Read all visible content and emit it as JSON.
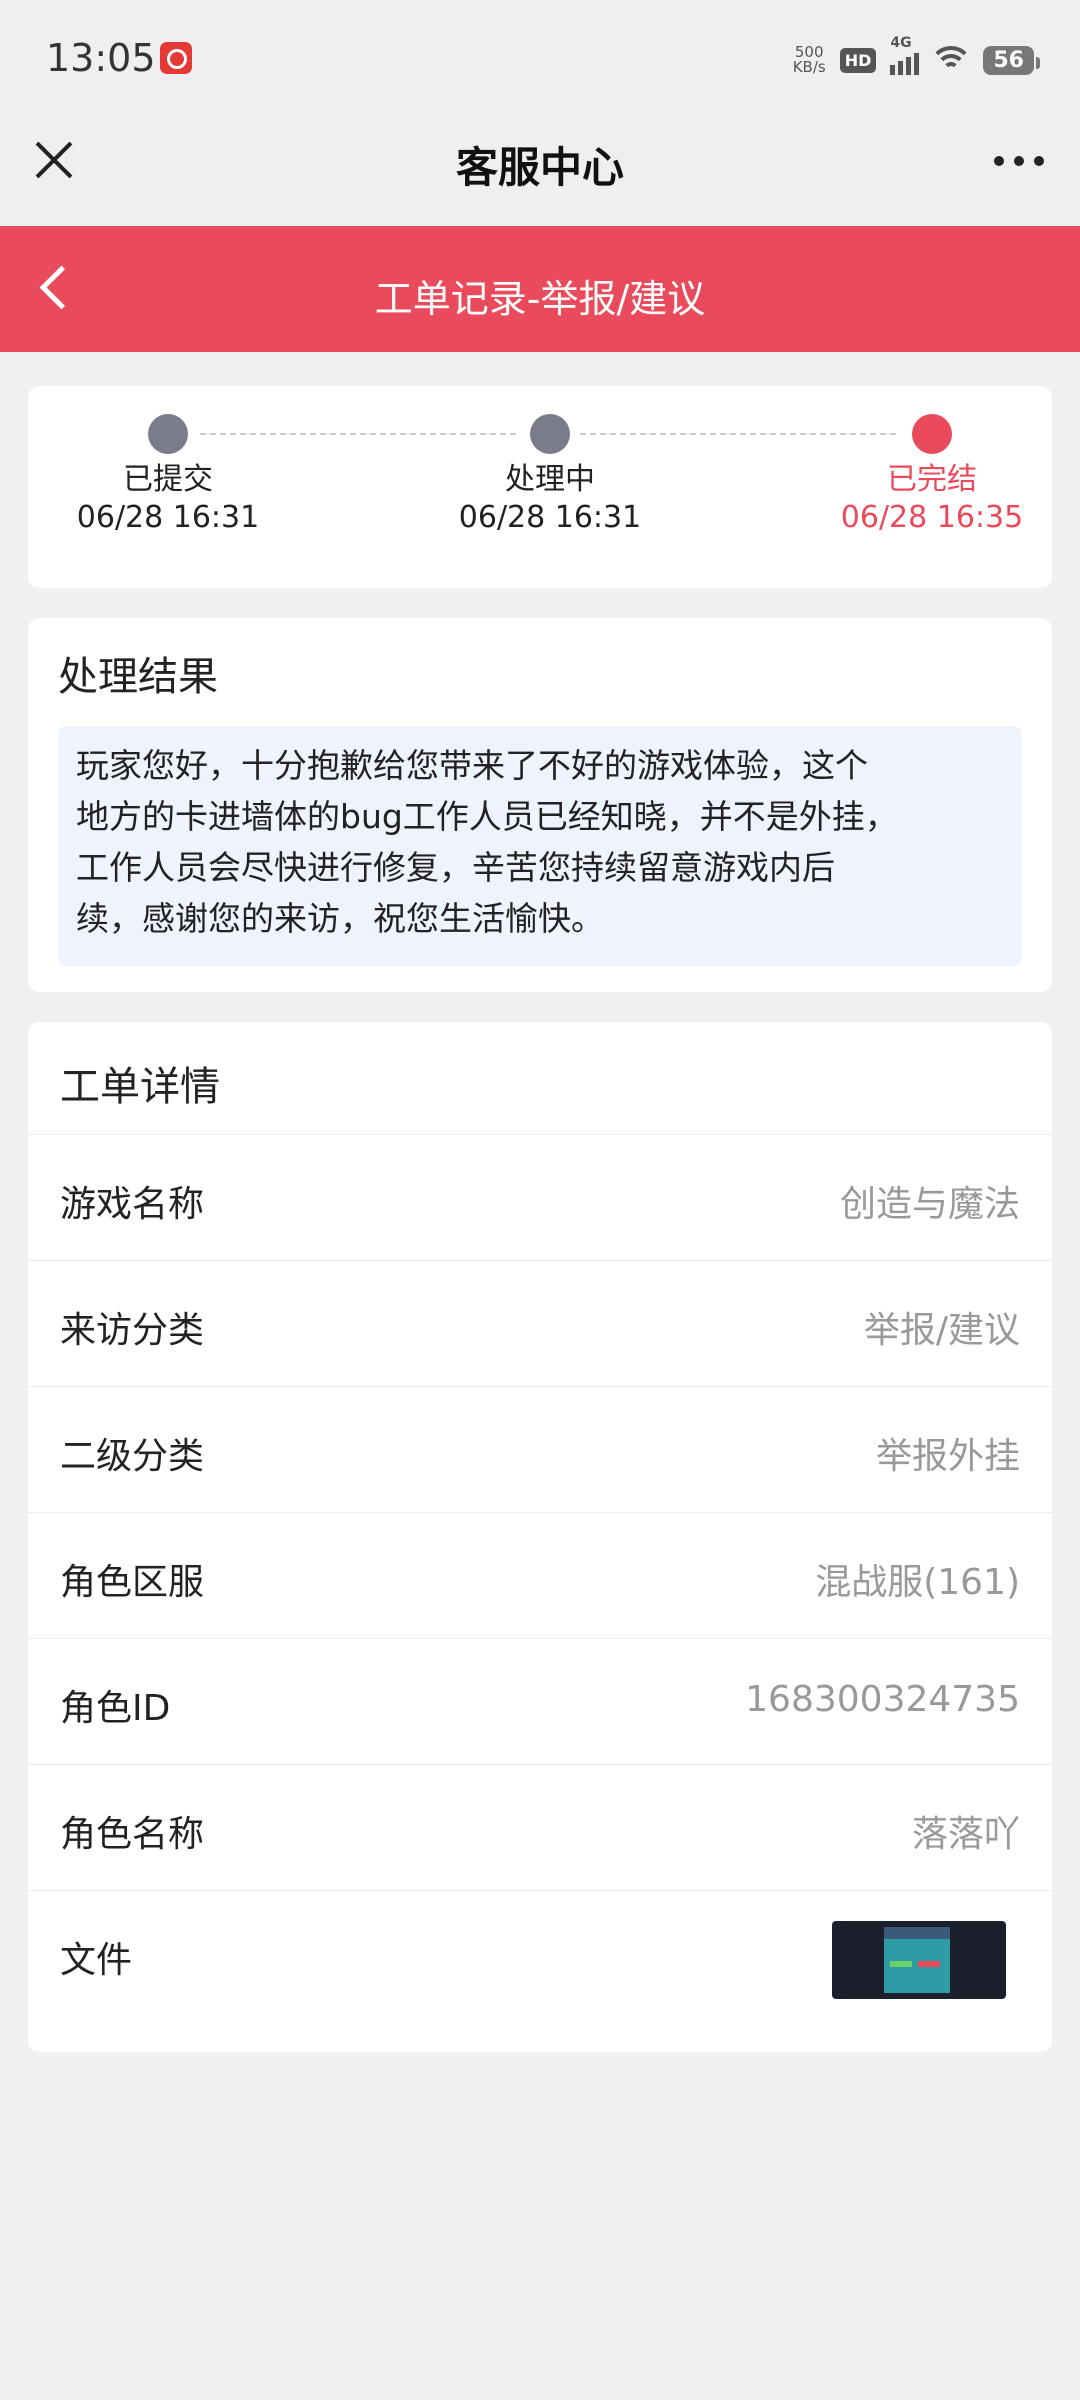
{
  "status_bar": {
    "time": "13:05",
    "net_speed_value": "500",
    "net_speed_unit": "KB/s",
    "hd_badge": "HD",
    "network_type": "4G",
    "battery": "56"
  },
  "nav": {
    "title": "客服中心"
  },
  "header": {
    "title": "工单记录-举报/建议"
  },
  "progress": {
    "steps": [
      {
        "label": "已提交",
        "date": "06/28 16:31"
      },
      {
        "label": "处理中",
        "date": "06/28 16:31"
      },
      {
        "label": "已完结",
        "date": "06/28 16:35"
      }
    ],
    "active_color": "#e94b5c",
    "inactive_color": "#7a7c8c"
  },
  "result": {
    "title": "处理结果",
    "lines": [
      "玩家您好，十分抱歉给您带来了不好的游戏体验，这个",
      "地方的卡进墙体的bug工作人员已经知晓，并不是外挂，",
      "工作人员会尽快进行修复，辛苦您持续留意游戏内后",
      "续，感谢您的来访，祝您生活愉快。"
    ]
  },
  "details": {
    "title": "工单详情",
    "rows": [
      {
        "label": "游戏名称",
        "value": "创造与魔法"
      },
      {
        "label": "来访分类",
        "value": "举报/建议"
      },
      {
        "label": "二级分类",
        "value": "举报外挂"
      },
      {
        "label": "角色区服",
        "value": "混战服(161)"
      },
      {
        "label": "角色ID",
        "value": "168300324735"
      },
      {
        "label": "角色名称",
        "value": "落落吖"
      },
      {
        "label": "文件",
        "value": ""
      }
    ]
  },
  "colors": {
    "accent": "#e94b5c",
    "background": "#f0f0f0",
    "result_box": "#eef3fd"
  }
}
